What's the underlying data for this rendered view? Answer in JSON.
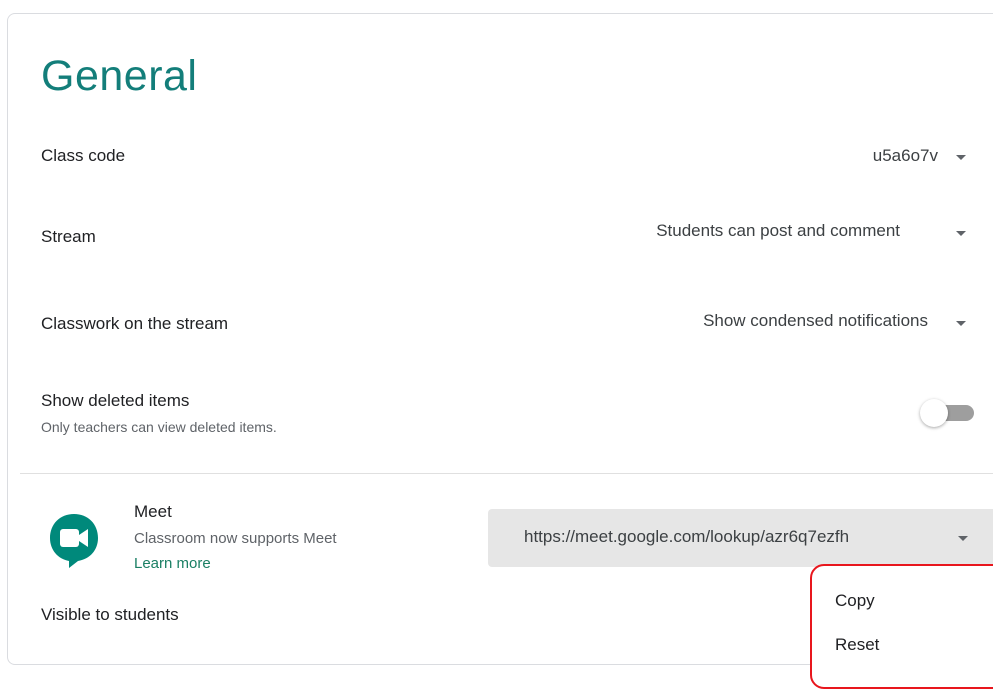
{
  "section": {
    "title": "General"
  },
  "class_code": {
    "label": "Class code",
    "value": "u5a6o7v"
  },
  "stream": {
    "label": "Stream",
    "value": "Students can post and comment"
  },
  "classwork": {
    "label": "Classwork on the stream",
    "value": "Show condensed notifications"
  },
  "deleted_items": {
    "label": "Show deleted items",
    "description": "Only teachers can view deleted items.",
    "enabled": false
  },
  "meet": {
    "title": "Meet",
    "description": "Classroom now supports Meet",
    "learn_more": "Learn more",
    "link": "https://meet.google.com/lookup/azr6q7ezfh",
    "visible_label": "Visible to students",
    "icon": "google-meet-icon"
  },
  "link_menu": {
    "items": [
      "Copy",
      "Reset"
    ]
  },
  "colors": {
    "title": "#137e7a",
    "meet_green": "#00897b",
    "link_bg": "#e6e6e6",
    "highlight_border": "#e8161d"
  }
}
